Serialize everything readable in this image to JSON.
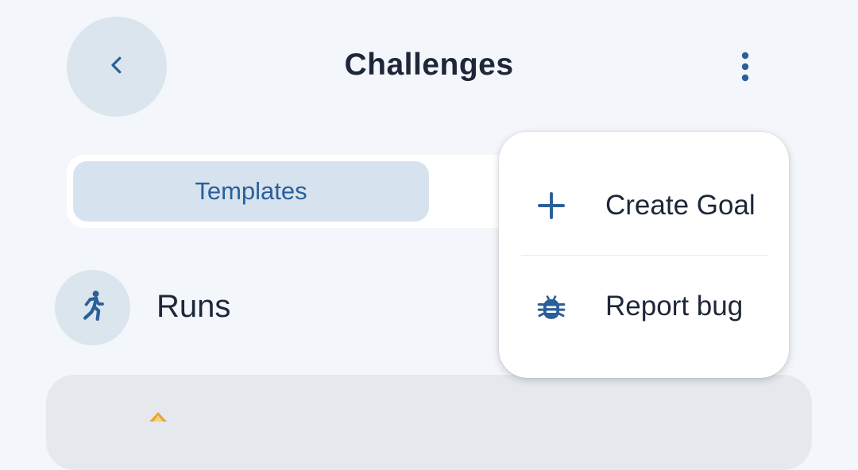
{
  "header": {
    "title": "Challenges",
    "back_icon": "chevron-left-icon",
    "more_icon": "more-vert-icon"
  },
  "tabs": {
    "active_label": "Templates"
  },
  "section": {
    "title": "Runs",
    "icon": "run-icon"
  },
  "overflow_menu": {
    "items": [
      {
        "label": "Create Goal",
        "icon": "plus-icon"
      },
      {
        "label": "Report bug",
        "icon": "bug-icon"
      }
    ]
  },
  "colors": {
    "background": "#f3f6fa",
    "accent": "#2a5f9a",
    "chip": "#dbe5ee",
    "text": "#1d2738",
    "badge": "#e8a33a"
  }
}
